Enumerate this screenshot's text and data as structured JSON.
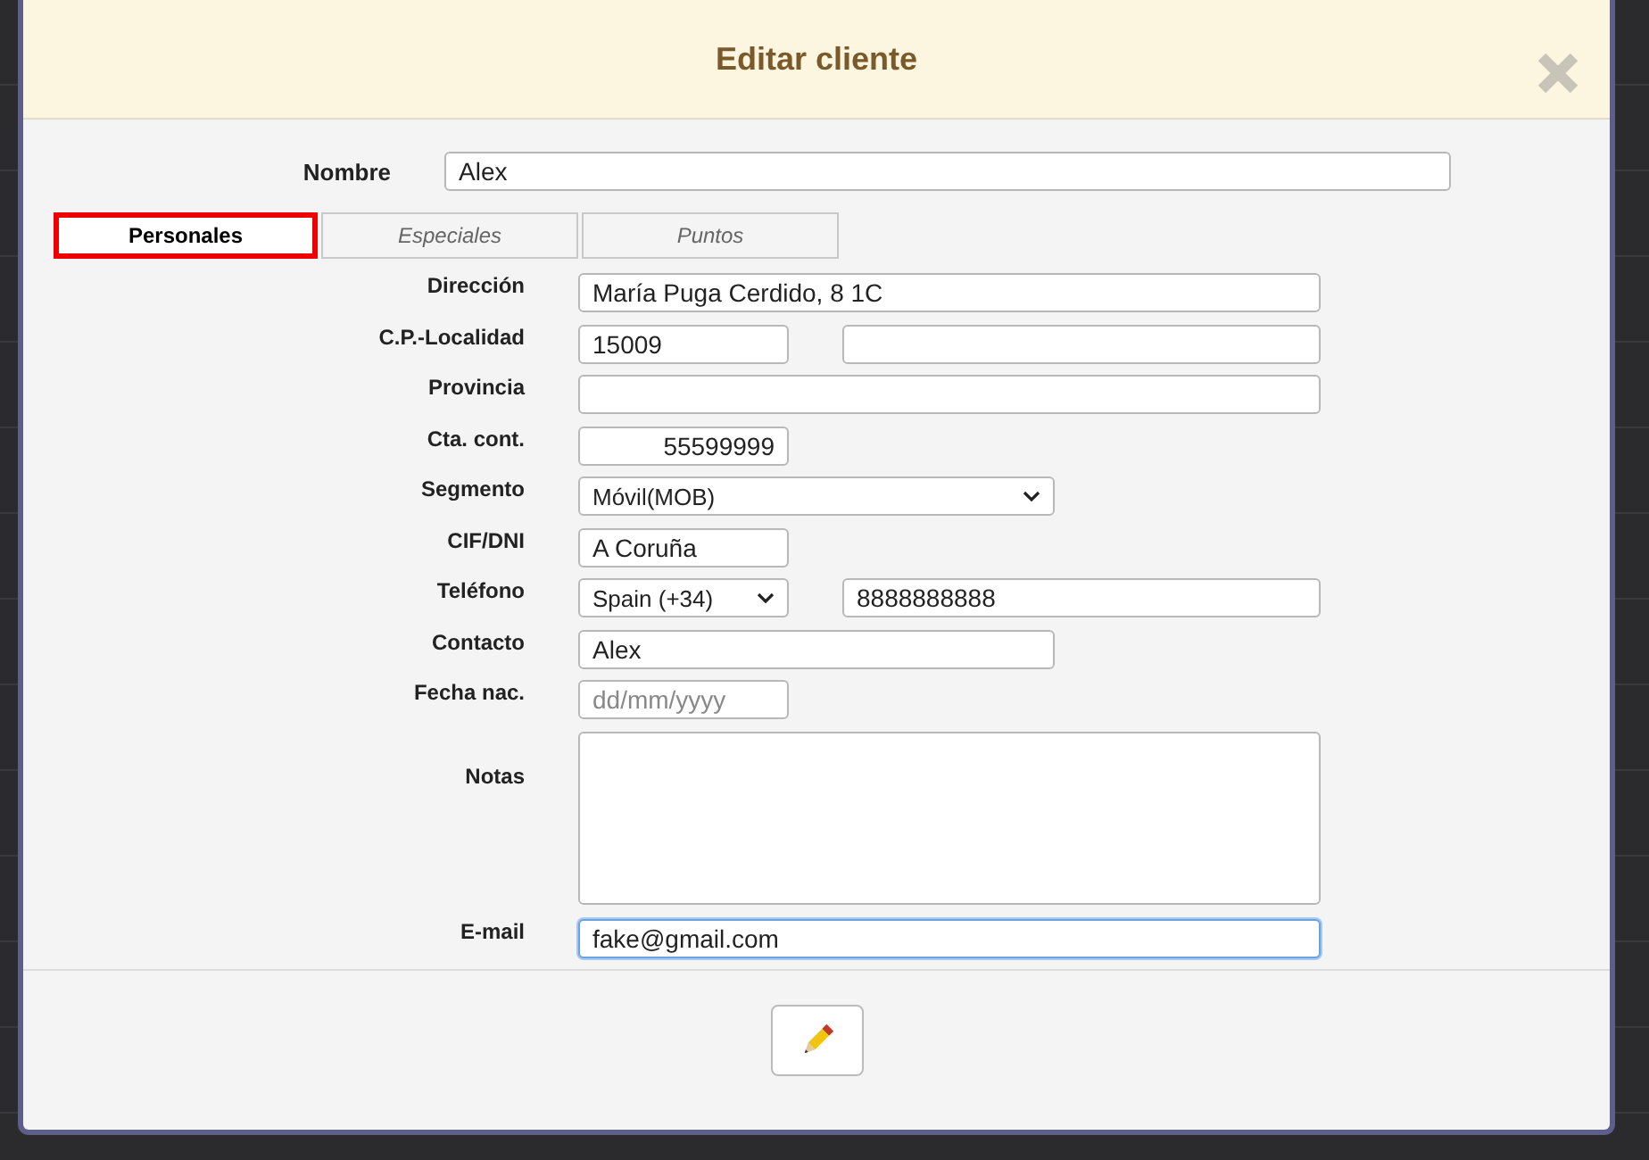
{
  "dialog": {
    "title": "Editar cliente"
  },
  "name_field": {
    "label": "Nombre",
    "value": "Alex"
  },
  "tabs": [
    {
      "label": "Personales",
      "selected": true
    },
    {
      "label": "Especiales",
      "selected": false
    },
    {
      "label": "Puntos",
      "selected": false
    }
  ],
  "fields": [
    {
      "label": "Dirección",
      "kind": "wide",
      "value": "María Puga Cerdido, 8 1C"
    },
    {
      "label": "C.P.-Localidad",
      "kind": "pair",
      "value": "15009"
    },
    {
      "label": "Provincia",
      "kind": "wide"
    },
    {
      "label": "Cta. cont.",
      "kind": "number",
      "value": "55599999"
    },
    {
      "label": "Segmento",
      "kind": "select",
      "value": "Móvil(MOB)"
    },
    {
      "label": "CIF/DNI",
      "kind": "short",
      "value": "A Coruña"
    },
    {
      "label": "Teléfono",
      "kind": "phone",
      "option": "Spain (+34)",
      "value": "8888888888"
    },
    {
      "label": "Contacto",
      "kind": "medium",
      "value": "Alex"
    },
    {
      "label": "Fecha nac.",
      "kind": "short",
      "placeholder": "dd/mm/yyyy"
    },
    {
      "label": "Notas",
      "kind": "notes"
    },
    {
      "label": "E-mail",
      "kind": "wide",
      "value": "fake@gmail.com",
      "focused": true
    }
  ]
}
